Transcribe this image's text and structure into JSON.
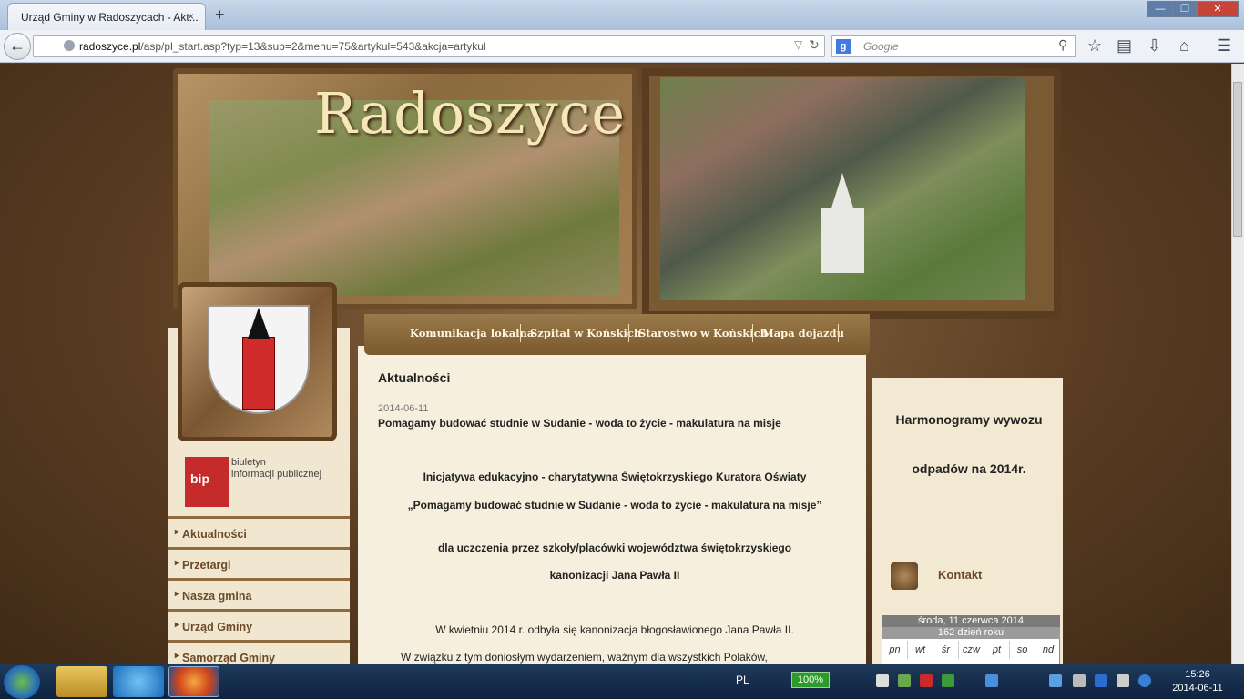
{
  "browser": {
    "tab_title": "Urząd Gminy w Radoszycach - Akt...",
    "tab_close": "×",
    "new_tab": "+",
    "url_domain": "radoszyce.pl",
    "url_path": "/asp/pl_start.asp?typ=13&sub=2&menu=75&artykul=543&akcja=artykul",
    "search_placeholder": "Google",
    "window_buttons": [
      "—",
      "❐",
      "✕"
    ]
  },
  "site": {
    "logo_text": "Radoszyce",
    "nav": [
      "Komunikacja lokalna",
      "Szpital w Końskich",
      "Starostwo w Końskich",
      "Mapa dojazdu"
    ],
    "bip": {
      "badge": "bip",
      "line1": "biuletyn",
      "line2": "informacji publicznej"
    },
    "menu": [
      "Aktualności",
      "Przetargi",
      "Nasza gmina",
      "Urząd Gminy",
      "Samorząd Gminy"
    ]
  },
  "article": {
    "section": "Aktualności",
    "date": "2014-06-11",
    "title": "Pomagamy budować studnie w  Sudanie - woda to życie - makulatura na misje",
    "lead1": "Inicjatywa  edukacyjno - charytatywna Świętokrzyskiego  Kuratora  Oświaty",
    "lead2": "„Pomagamy  budować  studnie  w  Sudanie - woda  to  życie - makulatura  na misje”",
    "lead3": "dla  uczczenia  przez  szkoły/placówki  województwa  świętokrzyskiego",
    "lead4": "kanonizacji  Jana  Pawła  II",
    "para1": "W kwietniu 2014 r.  odbyła  się kanonizacja  błogosławionego  Jana Pawła   II.",
    "para2": "W   związku   z   tym   doniosłym   wydarzeniem,   ważnym   dla wszystkich   Polaków,"
  },
  "sidebar": {
    "harm_line1": "Harmonogramy wywozu",
    "harm_line2": "odpadów na 2014r.",
    "contact": "Kontakt",
    "calendar": {
      "date": "środa, 11 czerwca 2014",
      "dayofyear": "162 dzień roku",
      "days": [
        "pn",
        "wt",
        "śr",
        "czw",
        "pt",
        "so",
        "nd"
      ]
    }
  },
  "taskbar": {
    "lang": "PL",
    "battery": "100%",
    "time": "15:26",
    "date": "2014-06-11"
  }
}
